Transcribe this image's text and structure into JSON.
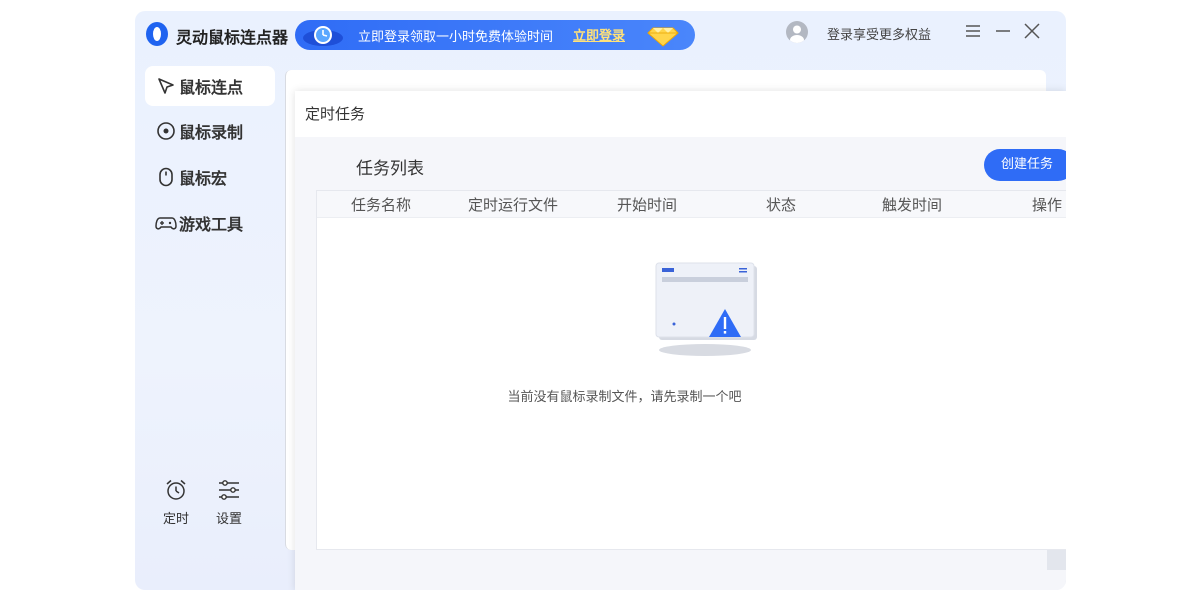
{
  "app": {
    "title": "灵动鼠标连点器"
  },
  "promo": {
    "text": "立即登录领取一小时免费体验时间",
    "link": "立即登录"
  },
  "header": {
    "login_text": "登录享受更多权益"
  },
  "sidebar": {
    "items": [
      {
        "label": "鼠标连点",
        "icon": "cursor-icon",
        "active": true
      },
      {
        "label": "鼠标录制",
        "icon": "record-icon",
        "active": false
      },
      {
        "label": "鼠标宏",
        "icon": "mouse-icon",
        "active": false
      },
      {
        "label": "游戏工具",
        "icon": "gamepad-icon",
        "active": false
      }
    ],
    "bottom": [
      {
        "label": "定时",
        "icon": "alarm-clock-icon"
      },
      {
        "label": "设置",
        "icon": "sliders-icon"
      }
    ]
  },
  "dialog": {
    "title": "定时任务",
    "list_title": "任务列表",
    "create_button": "创建任务",
    "columns": [
      "任务名称",
      "定时运行文件",
      "开始时间",
      "状态",
      "触发时间",
      "操作"
    ],
    "empty_text": "当前没有鼠标录制文件，请先录制一个吧"
  },
  "colors": {
    "accent": "#2f6cf6",
    "promo_link": "#ffe27a",
    "background": "#eaf1fe"
  }
}
